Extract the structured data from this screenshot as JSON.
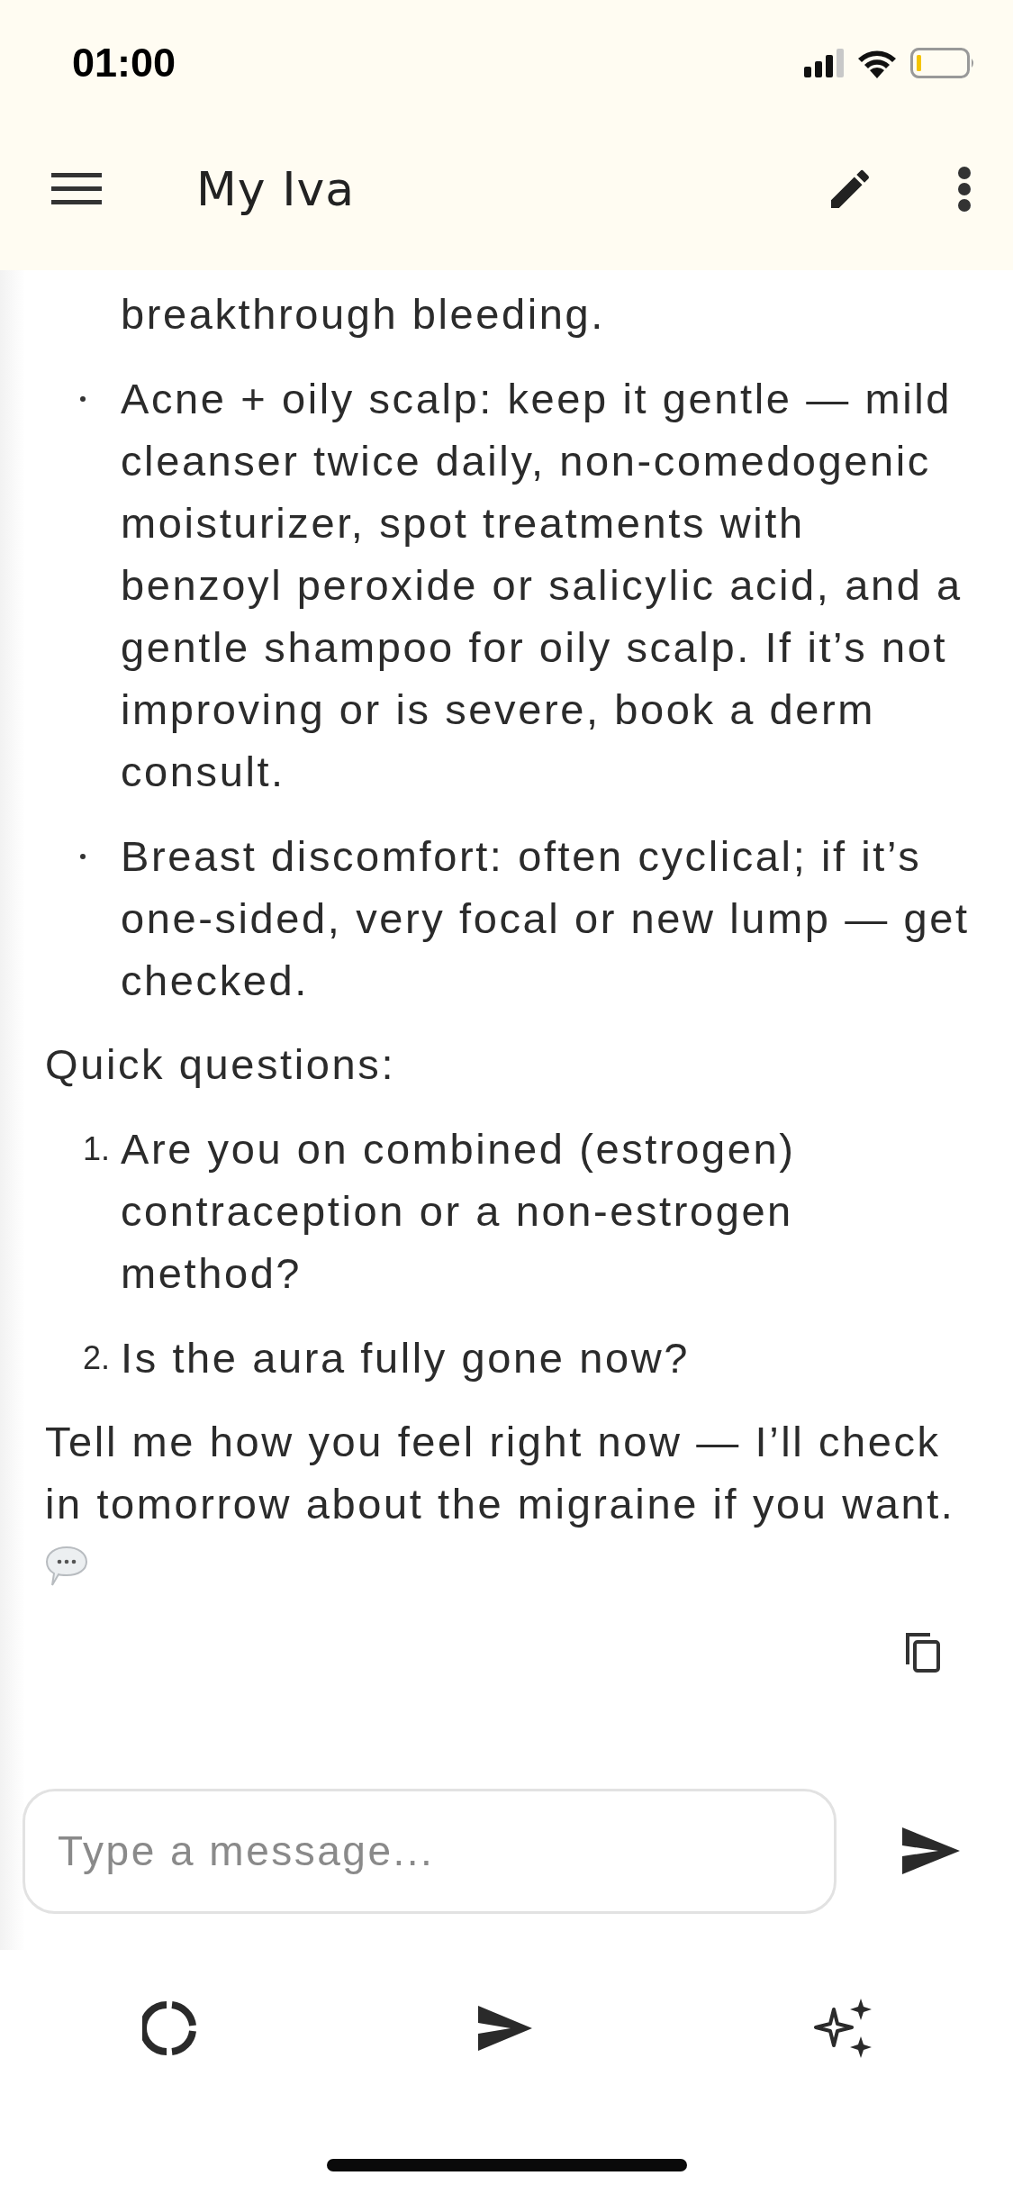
{
  "status_bar": {
    "time": "01:00"
  },
  "app_bar": {
    "title": "My Iva"
  },
  "message": {
    "continued_line": "breakthrough bleeding.",
    "bullets": [
      {
        "text": "Acne + oily scalp: keep it gentle — mild cleanser twice daily, non-comedogenic moisturizer, spot treatments with benzoyl peroxide or salicylic acid, and a gentle shampoo for oily scalp. If it’s not improving or is severe, book a derm consult."
      },
      {
        "text": "Breast discomfort: often cyclical; if it’s one-sided, very focal or new lump — get checked."
      }
    ],
    "heading": "Quick questions:",
    "questions": [
      {
        "number": "1.",
        "text": "Are you on combined (estrogen) contraception or a non-estrogen method?"
      },
      {
        "number": "2.",
        "text": "Is the aura fully gone now?"
      }
    ],
    "closing": "Tell me how you feel right now — I’ll check in tomorrow about the migraine if you want."
  },
  "composer": {
    "placeholder": "Type a message..."
  }
}
